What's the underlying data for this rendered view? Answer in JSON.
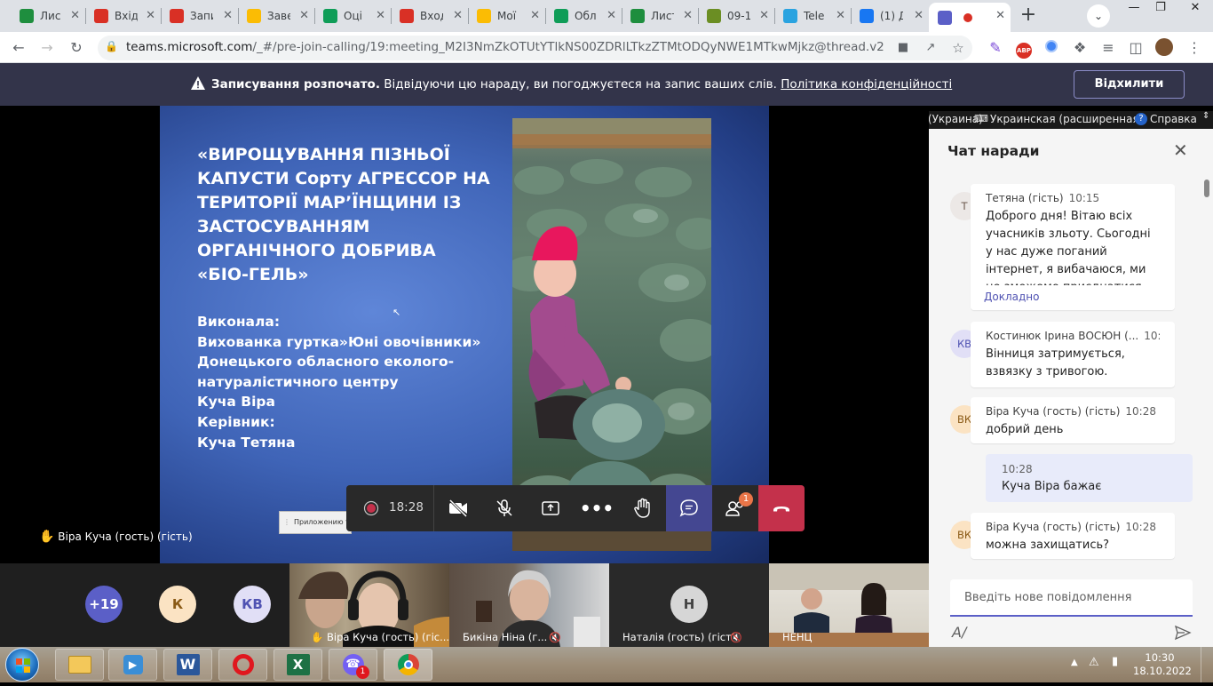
{
  "browser": {
    "tabs": [
      {
        "label": "Лис",
        "icon": "green-globe-icon",
        "color": "#1e8e3e"
      },
      {
        "label": "Вхід",
        "icon": "gmail-icon",
        "color": "#d93025"
      },
      {
        "label": "Запи",
        "icon": "gmail-icon",
        "color": "#d93025"
      },
      {
        "label": "Заве",
        "icon": "google-drive-icon",
        "color": "#fbbc04"
      },
      {
        "label": "Оці",
        "icon": "google-sheets-icon",
        "color": "#0f9d58"
      },
      {
        "label": "Вход",
        "icon": "gmail-icon",
        "color": "#d93025"
      },
      {
        "label": "Мої",
        "icon": "google-drive-icon",
        "color": "#fbbc04"
      },
      {
        "label": "Обл",
        "icon": "google-sheets-icon",
        "color": "#0f9d58"
      },
      {
        "label": "Лист",
        "icon": "green-globe-icon",
        "color": "#1e8e3e"
      },
      {
        "label": "09-1",
        "icon": "site-icon",
        "color": "#6b8e23"
      },
      {
        "label": "Tele",
        "icon": "telegram-icon",
        "color": "#2aa3e0"
      },
      {
        "label": "(1) Д",
        "icon": "facebook-icon",
        "color": "#1877f2"
      },
      {
        "label": "",
        "icon": "teams-icon",
        "color": "#5b5fc7"
      }
    ],
    "url_prefix": "teams.microsoft.com",
    "url_rest": "/_#/pre-join-calling/19:meeting_M2I3NmZkOTUtYTlkNS00ZDRlLTkzZTMtODQyNWE1MTkwMjkz@thread.v2"
  },
  "banner": {
    "bold": "Записування розпочато.",
    "text": " Відвідуючи цю нараду, ви погоджуєтеся на запис ваших слів. ",
    "link": "Політика конфіденційності",
    "dismiss": "Відхилити"
  },
  "slide": {
    "title": "«ВИРОЩУВАННЯ ПІЗНЬОЇ КАПУСТИ Сорту АГРЕССОР НА ТЕРИТОРІЇ МАР’ЇНЩИНИ ІЗ ЗАСТОСУВАННЯМ ОРГАНІЧНОГО ДОБРИВА «БІО-ГЕЛЬ»",
    "lines": [
      "Виконала:",
      "Вихованка гуртка»Юні овочівники»",
      "Донецького обласного еколого-",
      "натуралістичного центру",
      "Куча Віра",
      "Керівник:",
      "Куча Тетяна"
    ]
  },
  "popup_text": "Приложению те",
  "speaker_label": "Віра Куча (гость) (гість)",
  "callbar": {
    "record_time": "18:28",
    "people_badge": "1"
  },
  "participants": [
    {
      "type": "avatar",
      "text": "+19",
      "bg": "#5b5fc7",
      "fg": "#ffffff"
    },
    {
      "type": "avatar",
      "text": "К",
      "bg": "#fbe3c3",
      "fg": "#8a5a16"
    },
    {
      "type": "avatar",
      "text": "КВ",
      "bg": "#e1dff6",
      "fg": "#4f52b2"
    },
    {
      "type": "video",
      "name": "Віра Куча (гость) (гіс..."
    },
    {
      "type": "video",
      "name": "Бикіна Ніна (г..."
    },
    {
      "type": "avatar-tile",
      "text": "Н",
      "name": "Наталія (гость) (гість)"
    },
    {
      "type": "video",
      "name": "НЕНЦ"
    }
  ],
  "langbar": {
    "lang": "UK Украинский (Украина)",
    "layout": "Украинская (расширенная)",
    "help": "Справка"
  },
  "chat": {
    "title": "Чат наради",
    "messages": [
      {
        "initials": "Т",
        "av_bg": "#ece8e6",
        "av_fg": "#6d5a4f",
        "name": "Тетяна (гість)",
        "time": "10:15",
        "text": "Доброго дня! Вітаю всіх учасників зльоту.  Сьогодні у нас дуже поганий інтернет, я вибачаюся, ми не зможемо приєднатися. Бажаю жюрі",
        "more": "Докладно"
      },
      {
        "initials": "КВ",
        "av_bg": "#e1dff6",
        "av_fg": "#4f52b2",
        "name": "Костинюк Ірина ВОСЮН (...",
        "time": "10:25",
        "text": "Вінниця затримується, взвязку з тривогою."
      },
      {
        "initials": "ВК",
        "av_bg": "#fbe3c3",
        "av_fg": "#8a5a16",
        "name": "Віра Куча (гость) (гість)",
        "time": "10:28",
        "text": "добрий день"
      },
      {
        "initials": "ВК",
        "av_bg": "#fbe3c3",
        "av_fg": "#8a5a16",
        "name": "Віра Куча (гость) (гість)",
        "time": "10:28",
        "text": "можна захищатись?"
      }
    ],
    "my_message": {
      "time": "10:28",
      "text": "Куча Віра бажає"
    },
    "compose_placeholder": "Введіть нове повідомлення"
  },
  "taskbar": {
    "time": "10:30",
    "date": "18.10.2022",
    "viber_badge": "1"
  }
}
